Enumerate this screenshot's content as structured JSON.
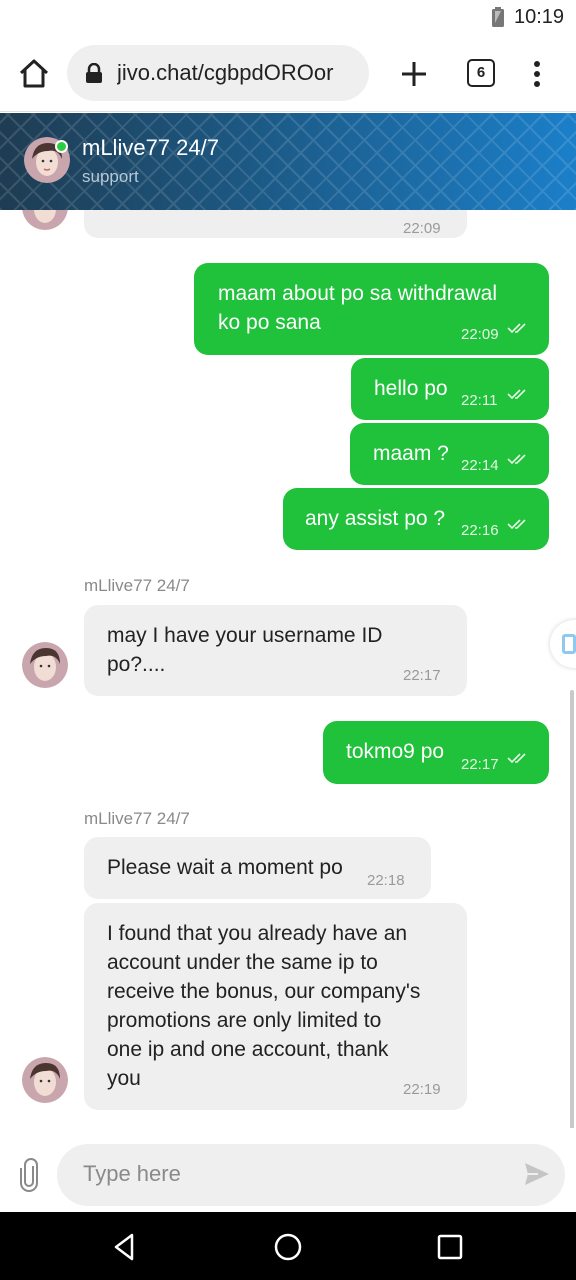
{
  "status_bar": {
    "time": "10:19"
  },
  "browser": {
    "url": "jivo.chat/cgbpdOROor",
    "tab_count": "6"
  },
  "chat_header": {
    "agent_name": "mLlive77 24/7",
    "subtitle": "support"
  },
  "messages": [
    {
      "direction": "in",
      "text": "",
      "time": "22:09"
    },
    {
      "direction": "out",
      "text": "maam about po sa withdrawal ko po sana",
      "line1": "maam about po sa withdrawal",
      "line2": "ko po sana",
      "time": "22:09"
    },
    {
      "direction": "out",
      "text": "hello po",
      "time": "22:11"
    },
    {
      "direction": "out",
      "text": "maam ?",
      "time": "22:14"
    },
    {
      "direction": "out",
      "text": "any assist po ?",
      "time": "22:16"
    },
    {
      "direction": "in",
      "sender": "mLlive77 24/7",
      "line1": "may I have your username ID",
      "line2": "po?....",
      "time": "22:17"
    },
    {
      "direction": "out",
      "text": "tokmo9 po",
      "time": "22:17"
    },
    {
      "direction": "in",
      "sender": "mLlive77 24/7",
      "text": "Please wait a moment po",
      "time": "22:18"
    },
    {
      "direction": "in",
      "lines": [
        "I found that you already have an",
        "account under the same ip to",
        "receive the bonus, our company's",
        "promotions are only limited to",
        "one ip and one account, thank",
        "you"
      ],
      "time": "22:19"
    }
  ],
  "input": {
    "placeholder": "Type here"
  },
  "icons": {
    "home": "home-icon",
    "lock": "lock-icon",
    "plus": "plus-icon",
    "menu": "more-vert-icon",
    "attach": "paperclip-icon",
    "send": "send-icon",
    "back": "back-icon",
    "home_nav": "home-circle-icon",
    "recents": "recents-icon"
  },
  "colors": {
    "outgoing_bubble": "#20c13b",
    "incoming_bubble": "#efefef",
    "online_dot": "#2ecc40"
  }
}
